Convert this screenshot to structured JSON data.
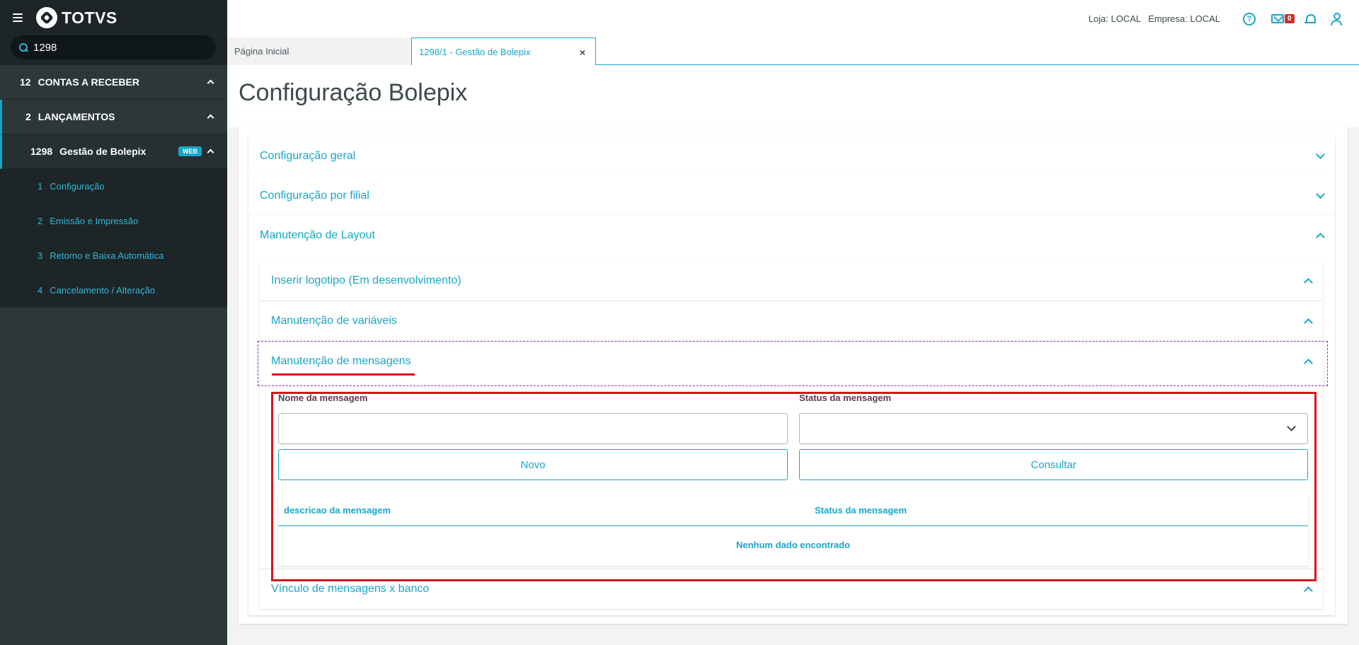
{
  "app": {
    "logo_text": "TOTVS"
  },
  "search": {
    "value": "1298"
  },
  "sidebar": {
    "items": [
      {
        "num": "12",
        "label": "CONTAS A RECEBER"
      },
      {
        "num": "2",
        "label": "LANÇAMENTOS"
      },
      {
        "num": "1298",
        "label": "Gestão de Bolepix",
        "badge": "WEB"
      },
      {
        "num": "1",
        "label": "Configuração"
      },
      {
        "num": "2",
        "label": "Emissão e Impressão"
      },
      {
        "num": "3",
        "label": "Retorno e Baixa Automática"
      },
      {
        "num": "4",
        "label": "Cancelamento / Alteração"
      }
    ]
  },
  "topbar": {
    "loja": "Loja: LOCAL",
    "empresa": "Empresa: LOCAL",
    "help": "?",
    "mail_count": "0"
  },
  "tabs": [
    {
      "label": "Página Inicial"
    },
    {
      "label": "1298/1 - Gestão de Bolepix",
      "close": "×"
    }
  ],
  "page": {
    "title": "Configuração Bolepix",
    "sections": [
      {
        "label": "Configuração geral"
      },
      {
        "label": "Configuração por filial"
      },
      {
        "label": "Manutenção de Layout"
      }
    ],
    "subsections": [
      {
        "label": "Inserir logotipo (Em desenvolvimento)"
      },
      {
        "label": "Manutenção de variáveis"
      },
      {
        "label": "Manutenção de mensagens"
      },
      {
        "label": "Vínculo de mensagens x banco"
      }
    ],
    "form": {
      "name_label": "Nome da mensagem",
      "name_value": "",
      "status_label": "Status da mensagem",
      "status_value": "",
      "btn_new": "Novo",
      "btn_search": "Consultar"
    },
    "grid": {
      "columns": [
        "descricao da mensagem",
        "Status da mensagem"
      ],
      "empty": "Nenhum dado encontrado"
    }
  }
}
